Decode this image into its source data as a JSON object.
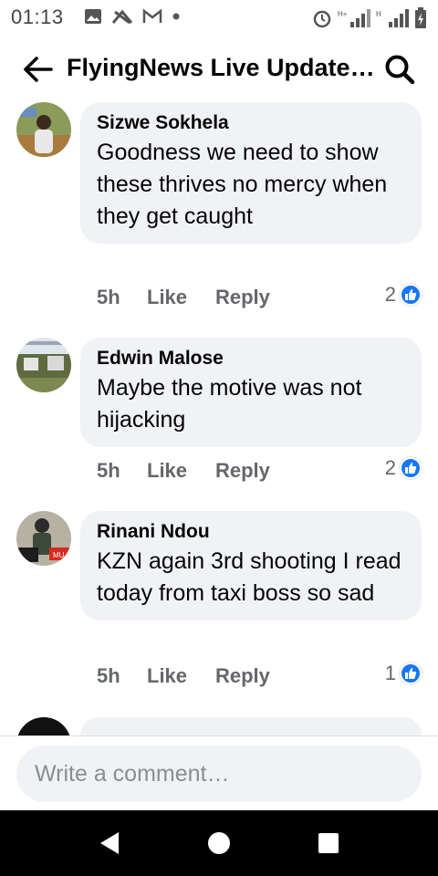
{
  "status_bar": {
    "time": "01:13",
    "left_icons": [
      "image-icon",
      "wifi-off-icon",
      "gmail-icon",
      "dot-icon"
    ],
    "right_icons": [
      "alarm-icon",
      "signal-h-plus-icon",
      "signal-h-icon",
      "battery-charging-icon"
    ]
  },
  "header": {
    "title": "FlyingNews Live Update…",
    "back_icon": "back-arrow-icon",
    "search_icon": "search-icon"
  },
  "comments": [
    {
      "author": "Sizwe Sokhela",
      "text": "Goodness we need to show these thrives no mercy  when they get caught",
      "time": "5h",
      "like_label": "Like",
      "reply_label": "Reply",
      "reaction_count": "2"
    },
    {
      "author": "Edwin Malose",
      "text": "Maybe the motive was not hijacking",
      "time": "5h",
      "like_label": "Like",
      "reply_label": "Reply",
      "reaction_count": "2"
    },
    {
      "author": "Rinani Ndou",
      "text": "KZN again 3rd shooting I read today from taxi boss so sad",
      "time": "5h",
      "like_label": "Like",
      "reply_label": "Reply",
      "reaction_count": "1"
    }
  ],
  "composer": {
    "placeholder": "Write a comment…"
  },
  "colors": {
    "accent": "#1877f2",
    "bubble": "#f0f2f5",
    "secondary_text": "#65676b"
  }
}
